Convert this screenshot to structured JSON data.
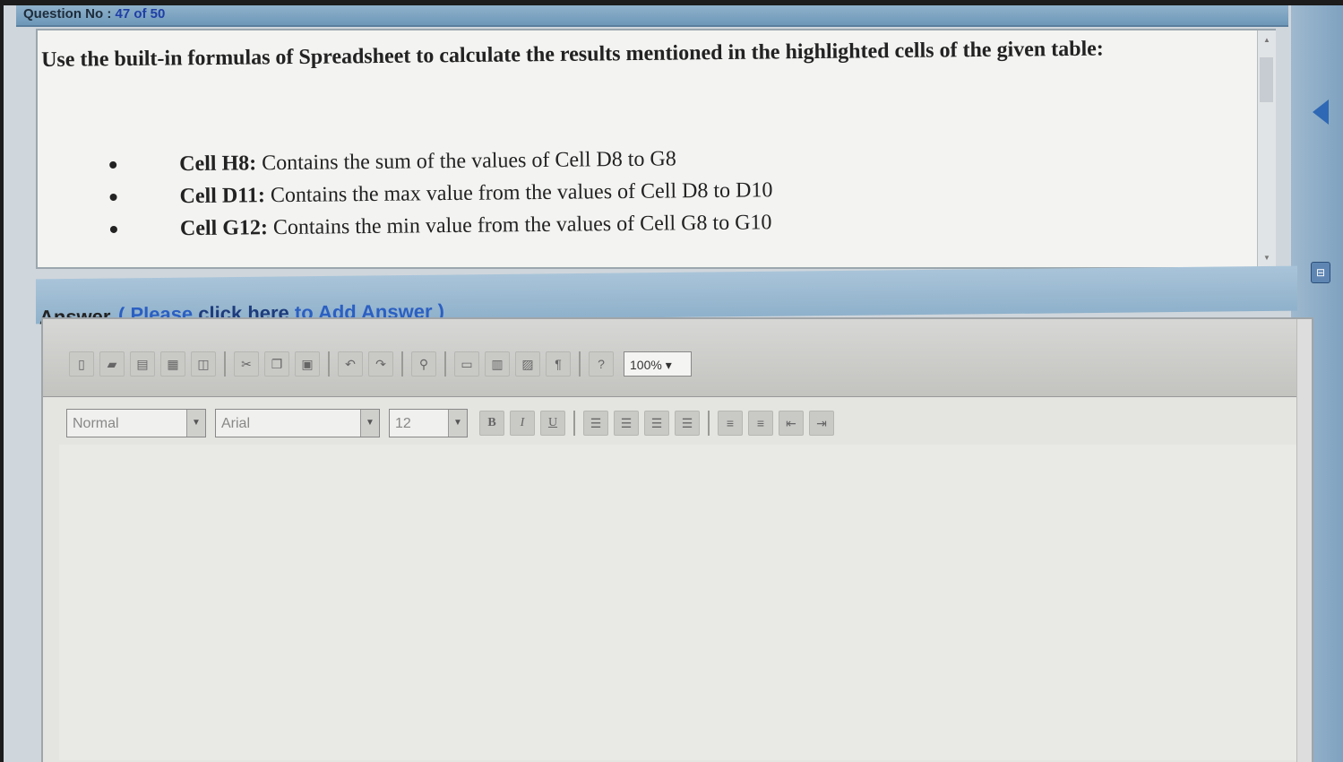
{
  "header": {
    "question_label": "Question No :",
    "question_number": "47 of 50"
  },
  "question": {
    "prompt": "Use the built-in formulas of Spreadsheet to calculate the results mentioned in the highlighted cells of the given table:",
    "items": [
      {
        "cell": "Cell H8:",
        "text": "Contains the sum of the values of Cell D8 to G8"
      },
      {
        "cell": "Cell D11:",
        "text": "Contains the max value from the values of Cell D8 to D10"
      },
      {
        "cell": "Cell G12:",
        "text": "Contains the min value from the values of Cell G8 to G10"
      }
    ]
  },
  "answer": {
    "label": "Answer",
    "open": "( Please ",
    "link": "click here",
    "close": " to Add Answer )"
  },
  "toolbar": {
    "zoom": "100%",
    "style": "Normal",
    "font": "Arial",
    "size": "12",
    "bold": "B",
    "italic": "I",
    "underline": "U",
    "help": "?"
  },
  "icons": [
    "new-doc-icon",
    "open-folder-icon",
    "save-icon",
    "print-icon",
    "print-preview-icon",
    "cut-icon",
    "copy-icon",
    "paste-icon",
    "undo-icon",
    "redo-icon",
    "find-icon",
    "insert-icon",
    "table-icon",
    "image-icon",
    "pilcrow-icon",
    "help-icon",
    "align-left-icon",
    "align-center-icon",
    "align-right-icon",
    "justify-icon",
    "numbered-list-icon",
    "bullet-list-icon",
    "outdent-icon",
    "indent-icon"
  ],
  "colors": {
    "header_bg": "#7fa3c1",
    "link_blue": "#2b5fc2"
  }
}
